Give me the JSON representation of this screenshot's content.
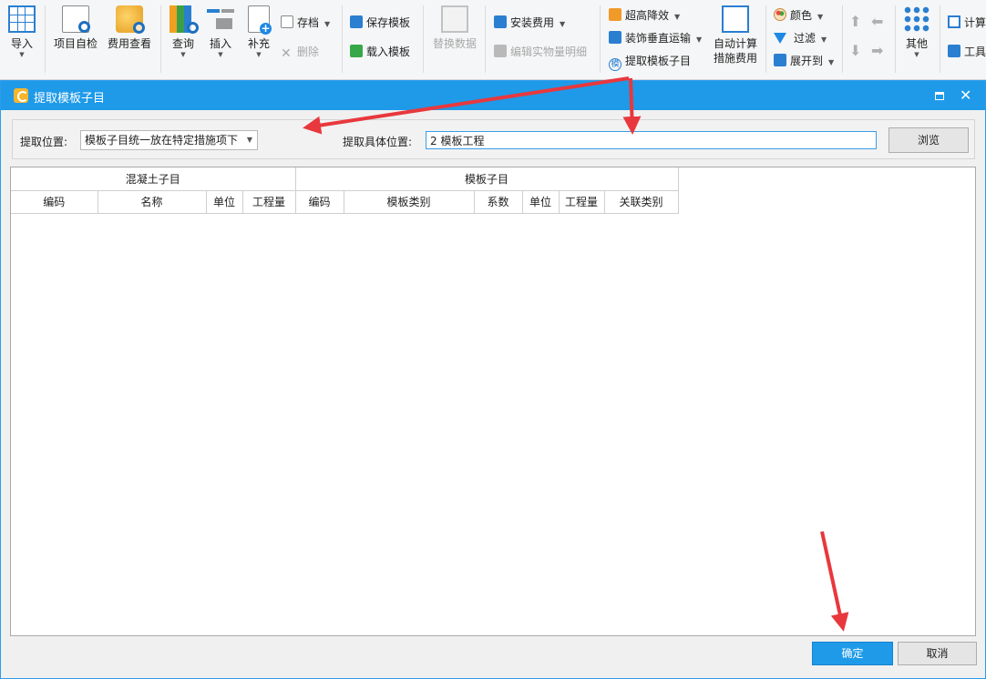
{
  "ribbon": {
    "import": "导入",
    "self_check": "项目自检",
    "fee_view": "费用查看",
    "query": "查询",
    "insert": "插入",
    "supplement": "补充",
    "archive": "存档",
    "delete": "删除",
    "save_template": "保存模板",
    "load_template": "载入模板",
    "replace_data": "替换数据",
    "install_fee": "安装费用",
    "edit_quantity": "编辑实物量明细",
    "super_high": "超高降效",
    "vertical_transport": "装饰垂直运输",
    "extract_formwork": "提取模板子目",
    "auto_calc_line1": "自动计算",
    "auto_calc_line2": "措施费用",
    "color": "颜色",
    "filter": "过滤",
    "expand_to": "展开到",
    "other": "其他",
    "calculate": "计算",
    "tools": "工具"
  },
  "dialog": {
    "title": "提取模板子目",
    "position_label": "提取位置:",
    "position_value": "模板子目统一放在特定措施项下",
    "detail_label": "提取具体位置:",
    "detail_value": "2 模板工程",
    "browse": "浏览",
    "ok": "确定",
    "cancel": "取消"
  },
  "table": {
    "group_concrete": "混凝土子目",
    "group_formwork": "模板子目",
    "columns": [
      "编码",
      "名称",
      "单位",
      "工程量",
      "编码",
      "模板类别",
      "系数",
      "单位",
      "工程量",
      "关联类别"
    ]
  },
  "colors": {
    "title_bar": "#1e9ae9",
    "ok_button": "#1e9ae9",
    "annotation_arrow": "#e8383d"
  }
}
